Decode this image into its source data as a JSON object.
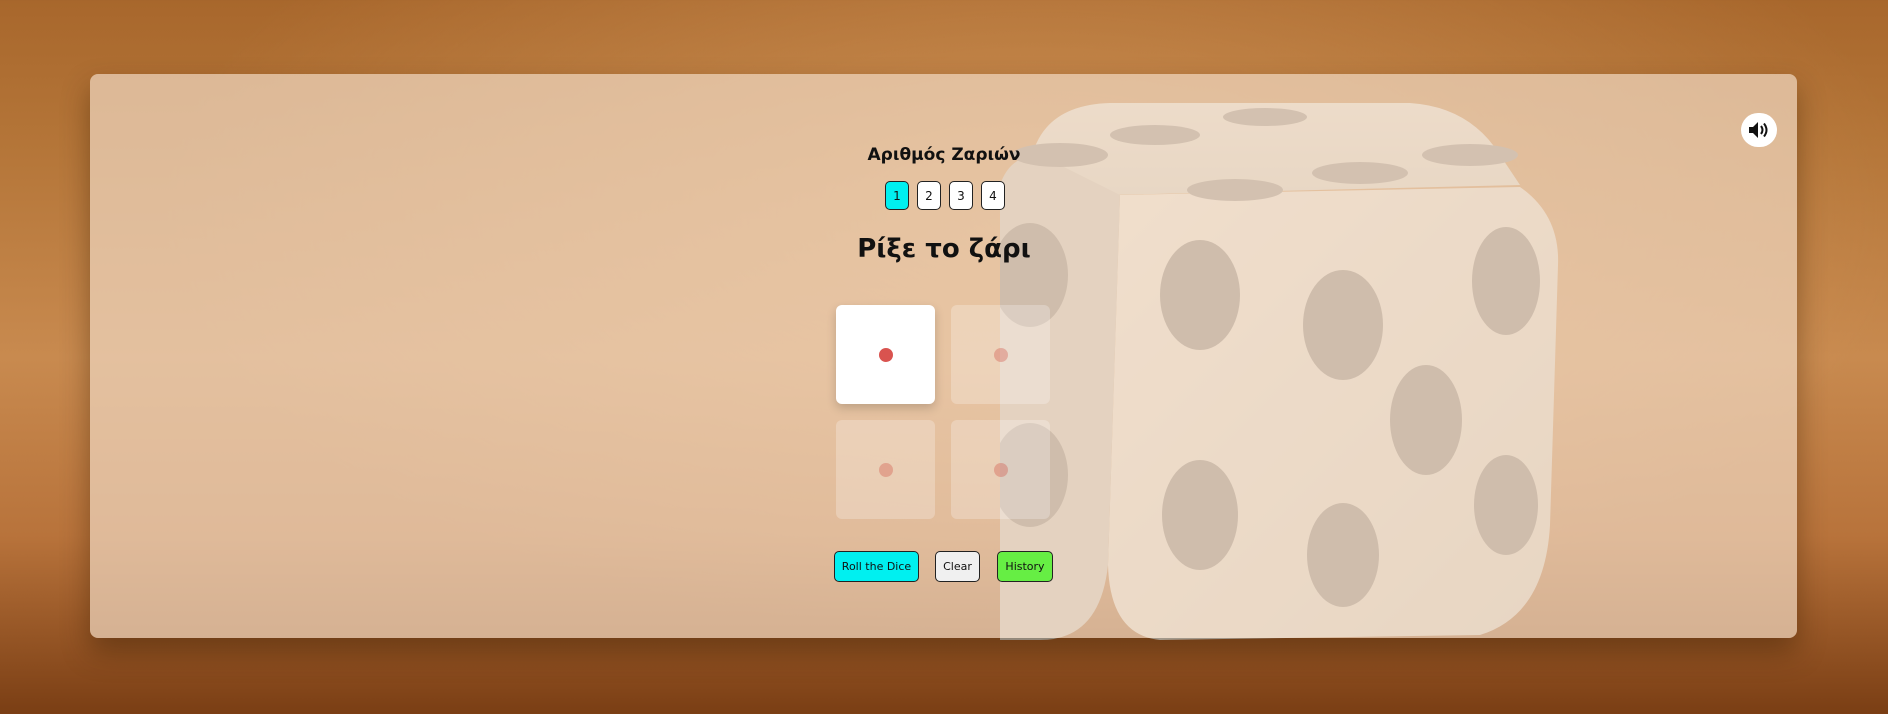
{
  "dice_count": {
    "title": "Αριθμός Ζαριών",
    "options": [
      "1",
      "2",
      "3",
      "4"
    ],
    "selected": "1"
  },
  "main_title": "Ρίξε το ζάρι",
  "dice": [
    {
      "value": 1,
      "active": true
    },
    {
      "value": 1,
      "active": false
    },
    {
      "value": 1,
      "active": false
    },
    {
      "value": 1,
      "active": false
    }
  ],
  "actions": {
    "roll_label": "Roll the Dice",
    "clear_label": "Clear",
    "history_label": "History"
  },
  "icons": {
    "sound": "speaker-volume-icon"
  },
  "colors": {
    "accent_cyan": "#00f0f0",
    "history_green": "#66ee44",
    "clear_gray": "#f0f0f0",
    "pip_red": "#d9534f"
  }
}
